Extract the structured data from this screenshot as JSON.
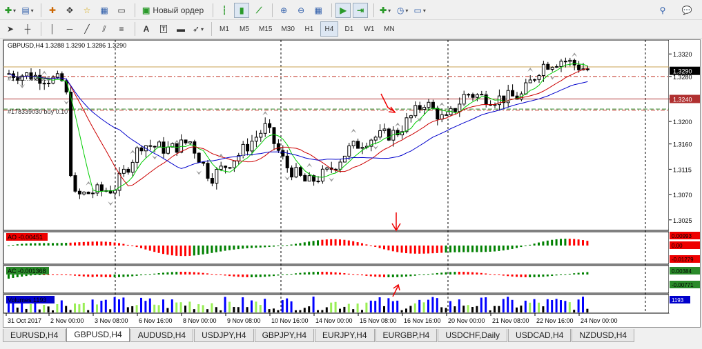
{
  "toolbar1": {
    "new_order_label": "Новый ордер"
  },
  "toolbar2": {
    "timeframes": [
      "M1",
      "M5",
      "M15",
      "M30",
      "H1",
      "H4",
      "D1",
      "W1",
      "MN"
    ],
    "active_timeframe": "H4"
  },
  "chart": {
    "info_line": "GBPUSD,H4  1.3288 1.3290 1.3286 1.3290",
    "order_label_1": "#1781...8.3 sell",
    "order_label_2": "#178339030 buy 0.10",
    "price_ticks": [
      "1.3320",
      "1.3280",
      "1.3240",
      "1.3200",
      "1.3160",
      "1.3115",
      "1.3070",
      "1.3025"
    ],
    "current_price": "1.3290",
    "order_price": "1.3240",
    "ao_label": "AO -0.00451",
    "ao_scale": [
      "0.00993",
      "0.00",
      "-0.01279"
    ],
    "ac_label": "AC -0.001368",
    "ac_scale": [
      "0.00384",
      "-0.00771"
    ],
    "vol_label": "Volumes 1193",
    "vol_scale": "1193",
    "date_labels": [
      "31 Oct 2017",
      "2 Nov 00:00",
      "3 Nov 08:00",
      "6 Nov 16:00",
      "8 Nov 00:00",
      "9 Nov 08:00",
      "10 Nov 16:00",
      "14 Nov 00:00",
      "15 Nov 08:00",
      "16 Nov 16:00",
      "20 Nov 00:00",
      "21 Nov 08:00",
      "22 Nov 16:00",
      "24 Nov 00:00"
    ],
    "colors": {
      "bull": "#ffffff",
      "bear": "#000000",
      "ma_fast": "#00cc00",
      "ma_mid": "#cc0000",
      "ma_slow": "#0000cc",
      "ao_up": "#008000",
      "ao_down": "#ff0000",
      "vol_blue": "#0000ff",
      "vol_green": "#99ee55",
      "vol_black": "#000000"
    }
  },
  "tabs": [
    "EURUSD,H4",
    "GBPUSD,H4",
    "AUDUSD,H4",
    "USDJPY,H4",
    "GBPJPY,H4",
    "EURJPY,H4",
    "EURGBP,H4",
    "USDCHF,Daily",
    "USDCAD,H4",
    "NZDUSD,H4"
  ],
  "active_tab": "GBPUSD,H4"
}
